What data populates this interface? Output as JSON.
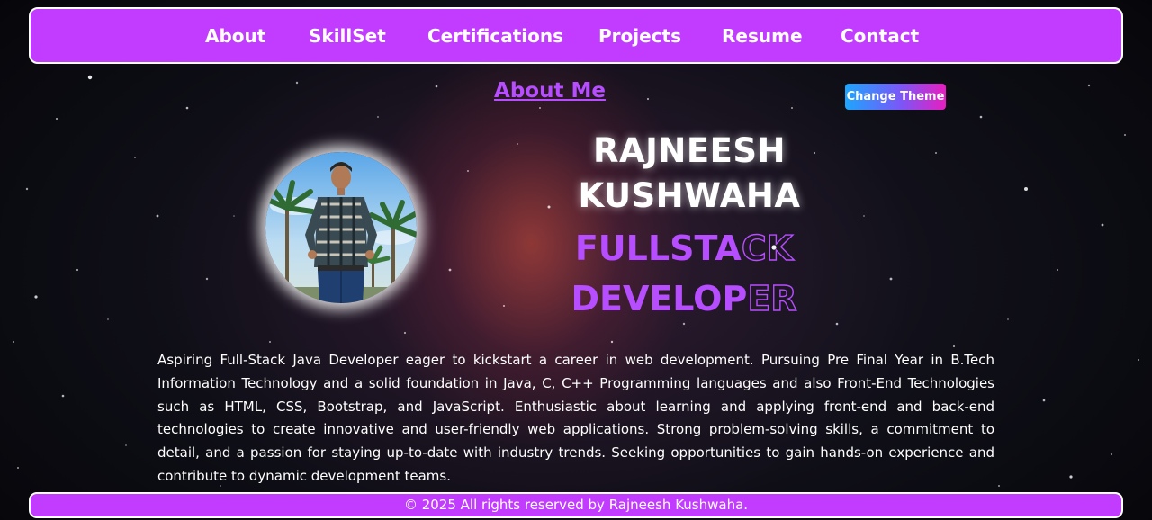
{
  "nav": {
    "items": [
      {
        "label": "About"
      },
      {
        "label": "SkillSet"
      },
      {
        "label": "Certifications"
      },
      {
        "label": "Projects"
      },
      {
        "label": "Resume"
      },
      {
        "label": "Contact"
      }
    ]
  },
  "about": {
    "title": "About Me",
    "theme_button": "Change Theme",
    "name_first": "RAJNEESH",
    "name_last": "KUSHWAHA",
    "role_line1_solid": "FULLSTA",
    "role_line1_outline": "CK",
    "role_line2_solid": "DEVELOP",
    "role_line2_outline": "ER",
    "bio": "Aspiring Full-Stack Java Developer eager to kickstart a career in web development. Pursuing Pre Final Year in B.Tech Information Technology and a solid foundation in Java, C, C++ Programming languages and also Front-End Technologies such as HTML, CSS, Bootstrap, and JavaScript. Enthusiastic about learning and applying front-end and back-end technologies to create innovative and user-friendly web applications. Strong problem-solving skills, a commitment to detail, and a passion for staying up-to-date with industry trends. Seeking opportunities to gain hands-on experience and contribute to dynamic development teams."
  },
  "footer": {
    "text": "© 2025 All rights reserved by Rajneesh Kushwaha."
  },
  "colors": {
    "accent": "#c23cff",
    "title": "#b64dff",
    "theme_gradient_start": "#1da6ff",
    "theme_gradient_end": "#e81ec0"
  }
}
